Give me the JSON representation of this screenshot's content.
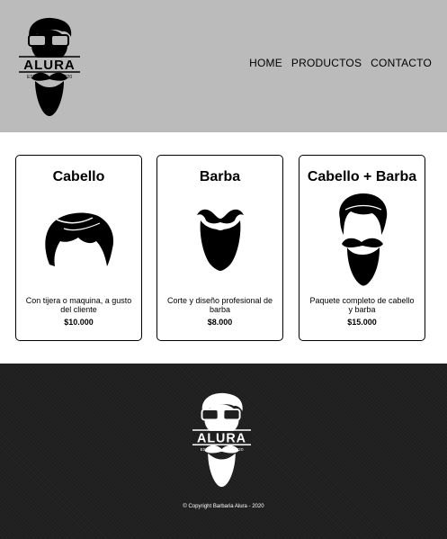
{
  "header": {
    "logo": {
      "brand": "ALURA",
      "est_left": "ESTD",
      "est_right": "2020"
    },
    "nav": [
      {
        "label": "HOME"
      },
      {
        "label": "PRODUCTOS"
      },
      {
        "label": "CONTACTO"
      }
    ]
  },
  "products": [
    {
      "title": "Cabello",
      "description": "Con tijera o maquina, a gusto del cliente",
      "price": "$10.000",
      "icon": "hair-icon"
    },
    {
      "title": "Barba",
      "description": "Corte y diseño profesional de barba",
      "price": "$8.000",
      "icon": "beard-icon"
    },
    {
      "title": "Cabello + Barba",
      "description": "Paquete completo de cabello y barba",
      "price": "$15.000",
      "icon": "hair-and-beard-icon"
    }
  ],
  "footer": {
    "logo": {
      "brand": "ALURA",
      "est_left": "ESTD",
      "est_right": "2020"
    },
    "copyright": "© Copyright Barbaria Alura - 2020"
  },
  "colors": {
    "header_bg": "#bbbbbb",
    "footer_bg": "#1f1f1f",
    "text": "#000000"
  }
}
